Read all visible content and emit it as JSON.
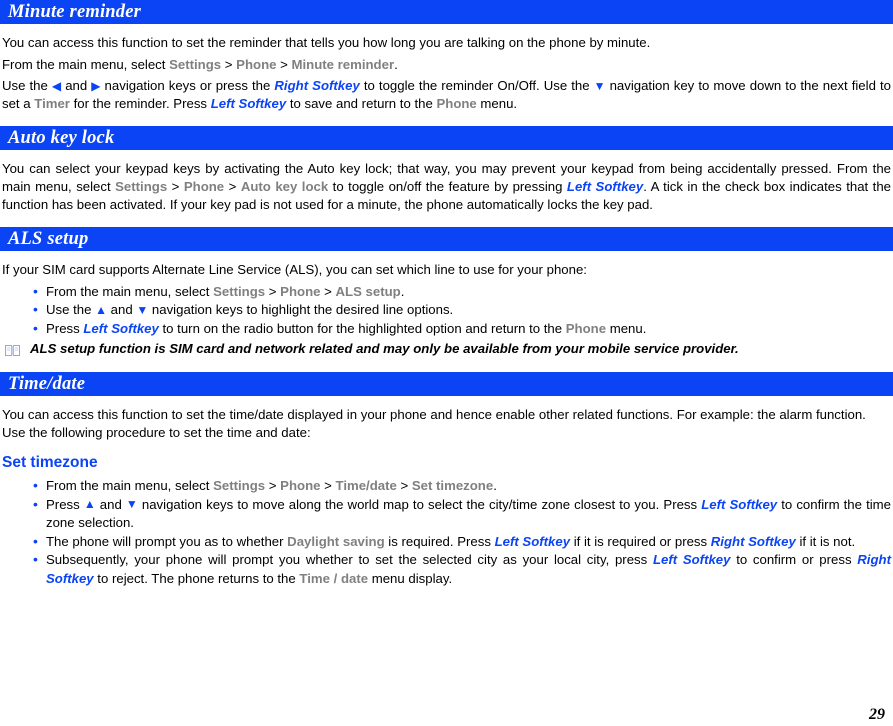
{
  "page": {
    "number": "29"
  },
  "colors": {
    "header_bar": "#0a44f5",
    "accent_blue": "#0a44f5",
    "menu_gray": "#808080",
    "text_black": "#000000",
    "header_text": "#ffffff"
  },
  "sections": [
    {
      "id": "minute-reminder",
      "title": "Minute reminder",
      "paragraphs": [
        {
          "id": "intro",
          "text": "You can access this function to set the reminder that tells you how long you are talking on the phone by minute."
        },
        {
          "id": "navigate",
          "parts": [
            {
              "type": "text",
              "value": "From the main menu,  select "
            },
            {
              "type": "menu",
              "value": "Settings"
            },
            {
              "type": "text",
              "value": " > "
            },
            {
              "type": "menu",
              "value": "Phone"
            },
            {
              "type": "text",
              "value": " > "
            },
            {
              "type": "menu",
              "value": "Minute reminder"
            },
            {
              "type": "text",
              "value": "."
            }
          ]
        },
        {
          "id": "usage",
          "parts": [
            {
              "type": "text",
              "value": "Use the "
            },
            {
              "type": "icon",
              "value": "◀",
              "name": "left-arrow-icon"
            },
            {
              "type": "text",
              "value": " and "
            },
            {
              "type": "icon",
              "value": "▶",
              "name": "right-arrow-icon"
            },
            {
              "type": "text",
              "value": " navigation keys or press the "
            },
            {
              "type": "softkey",
              "value": "Right Softkey"
            },
            {
              "type": "text",
              "value": " to toggle the reminder On/Off.  Use the "
            },
            {
              "type": "icon",
              "value": "▼",
              "name": "down-arrow-icon"
            },
            {
              "type": "text",
              "value": " navigation key to move down to the next field to set a "
            },
            {
              "type": "menu",
              "value": "Timer"
            },
            {
              "type": "text",
              "value": " for the reminder. Press "
            },
            {
              "type": "softkey",
              "value": "Left Softkey"
            },
            {
              "type": "text",
              "value": "  to save and return to the "
            },
            {
              "type": "menu",
              "value": "Phone"
            },
            {
              "type": "text",
              "value": " menu."
            }
          ]
        }
      ]
    },
    {
      "id": "auto-key-lock",
      "title": "Auto key lock",
      "paragraphs": [
        {
          "id": "auto-key-lock-body",
          "parts": [
            {
              "type": "text",
              "value": "You can select your keypad keys by activating the Auto key lock; that way, you may prevent your keypad from being accidentally pressed. From the main menu,  select "
            },
            {
              "type": "menu",
              "value": "Settings"
            },
            {
              "type": "text",
              "value": " > "
            },
            {
              "type": "menu",
              "value": "Phone"
            },
            {
              "type": "text",
              "value": " > "
            },
            {
              "type": "menu",
              "value": "Auto key lock"
            },
            {
              "type": "text",
              "value": " to toggle on/off the feature by pressing "
            },
            {
              "type": "softkey",
              "value": "Left Softkey"
            },
            {
              "type": "text",
              "value": ". A tick in the check box indicates that the function has been activated. If your key pad is not used for a minute, the phone automatically locks the key pad."
            }
          ]
        }
      ]
    },
    {
      "id": "als-setup",
      "title": "ALS setup",
      "paragraphs": [
        {
          "id": "als-intro",
          "text": "If your SIM card supports Alternate Line Service (ALS), you can set which line to use for your phone:"
        }
      ],
      "bullets": [
        {
          "id": "als-bullet-1",
          "parts": [
            {
              "type": "text",
              "value": "From the main menu, select "
            },
            {
              "type": "menu",
              "value": "Settings"
            },
            {
              "type": "text",
              "value": " > "
            },
            {
              "type": "menu",
              "value": "Phone"
            },
            {
              "type": "text",
              "value": " > "
            },
            {
              "type": "menu",
              "value": "ALS setup"
            },
            {
              "type": "text",
              "value": "."
            }
          ]
        },
        {
          "id": "als-bullet-2",
          "parts": [
            {
              "type": "text",
              "value": "Use the "
            },
            {
              "type": "icon",
              "value": "▲",
              "name": "up-arrow-icon"
            },
            {
              "type": "text",
              "value": " and "
            },
            {
              "type": "icon",
              "value": "▼",
              "name": "down-arrow-icon"
            },
            {
              "type": "text",
              "value": " navigation keys to highlight the desired line options."
            }
          ]
        },
        {
          "id": "als-bullet-3",
          "parts": [
            {
              "type": "text",
              "value": "Press "
            },
            {
              "type": "softkey",
              "value": "Left Softkey"
            },
            {
              "type": "text",
              "value": "  to turn on the radio button for the highlighted option and return to the "
            },
            {
              "type": "menu",
              "value": "Phone"
            },
            {
              "type": "text",
              "value": " menu."
            }
          ]
        }
      ],
      "note": {
        "icon": "book-icon",
        "text": "ALS setup function is SIM card and network related and may only be available from your mobile service provider."
      }
    },
    {
      "id": "time-date",
      "title": "Time/date",
      "paragraphs": [
        {
          "id": "time-date-intro",
          "text": "You can access this function to set the time/date displayed in your phone and hence enable other related functions. For example: the alarm function. Use the following procedure to set the time and date:"
        }
      ],
      "subheading": "Set timezone",
      "bullets": [
        {
          "id": "tz-bullet-1",
          "parts": [
            {
              "type": "text",
              "value": "From the main menu, select "
            },
            {
              "type": "menu",
              "value": "Settings"
            },
            {
              "type": "text",
              "value": " > "
            },
            {
              "type": "menu",
              "value": "Phone"
            },
            {
              "type": "text",
              "value": " > "
            },
            {
              "type": "menu",
              "value": "Time/date"
            },
            {
              "type": "text",
              "value": " > "
            },
            {
              "type": "menu",
              "value": "Set timezone"
            },
            {
              "type": "text",
              "value": "."
            }
          ]
        },
        {
          "id": "tz-bullet-2",
          "parts": [
            {
              "type": "text",
              "value": "Press "
            },
            {
              "type": "icon",
              "value": "▲",
              "name": "up-arrow-icon"
            },
            {
              "type": "text",
              "value": " and "
            },
            {
              "type": "icon",
              "value": "▼",
              "name": "down-arrow-icon"
            },
            {
              "type": "text",
              "value": " navigation keys to move along the world map to select the city/time zone closest to you. Press "
            },
            {
              "type": "softkey",
              "value": "Left Softkey"
            },
            {
              "type": "text",
              "value": "  to confirm the time zone selection."
            }
          ]
        },
        {
          "id": "tz-bullet-3",
          "parts": [
            {
              "type": "text",
              "value": "The phone will prompt you as to whether "
            },
            {
              "type": "menu",
              "value": "Daylight saving"
            },
            {
              "type": "text",
              "value": " is required. Press "
            },
            {
              "type": "softkey",
              "value": "Left Softkey"
            },
            {
              "type": "text",
              "value": " if it is required or press "
            },
            {
              "type": "softkey",
              "value": "Right Softkey"
            },
            {
              "type": "text",
              "value": "  if it is not."
            }
          ]
        },
        {
          "id": "tz-bullet-4",
          "parts": [
            {
              "type": "text",
              "value": "Subsequently, your phone will prompt you whether to set the selected city as your local city, press "
            },
            {
              "type": "softkey",
              "value": "Left Softkey"
            },
            {
              "type": "text",
              "value": " to confirm or press "
            },
            {
              "type": "softkey",
              "value": "Right Softkey"
            },
            {
              "type": "text",
              "value": " to reject. The phone returns to the "
            },
            {
              "type": "menu",
              "value": "Time / date"
            },
            {
              "type": "text",
              "value": " menu display."
            }
          ]
        }
      ]
    }
  ]
}
